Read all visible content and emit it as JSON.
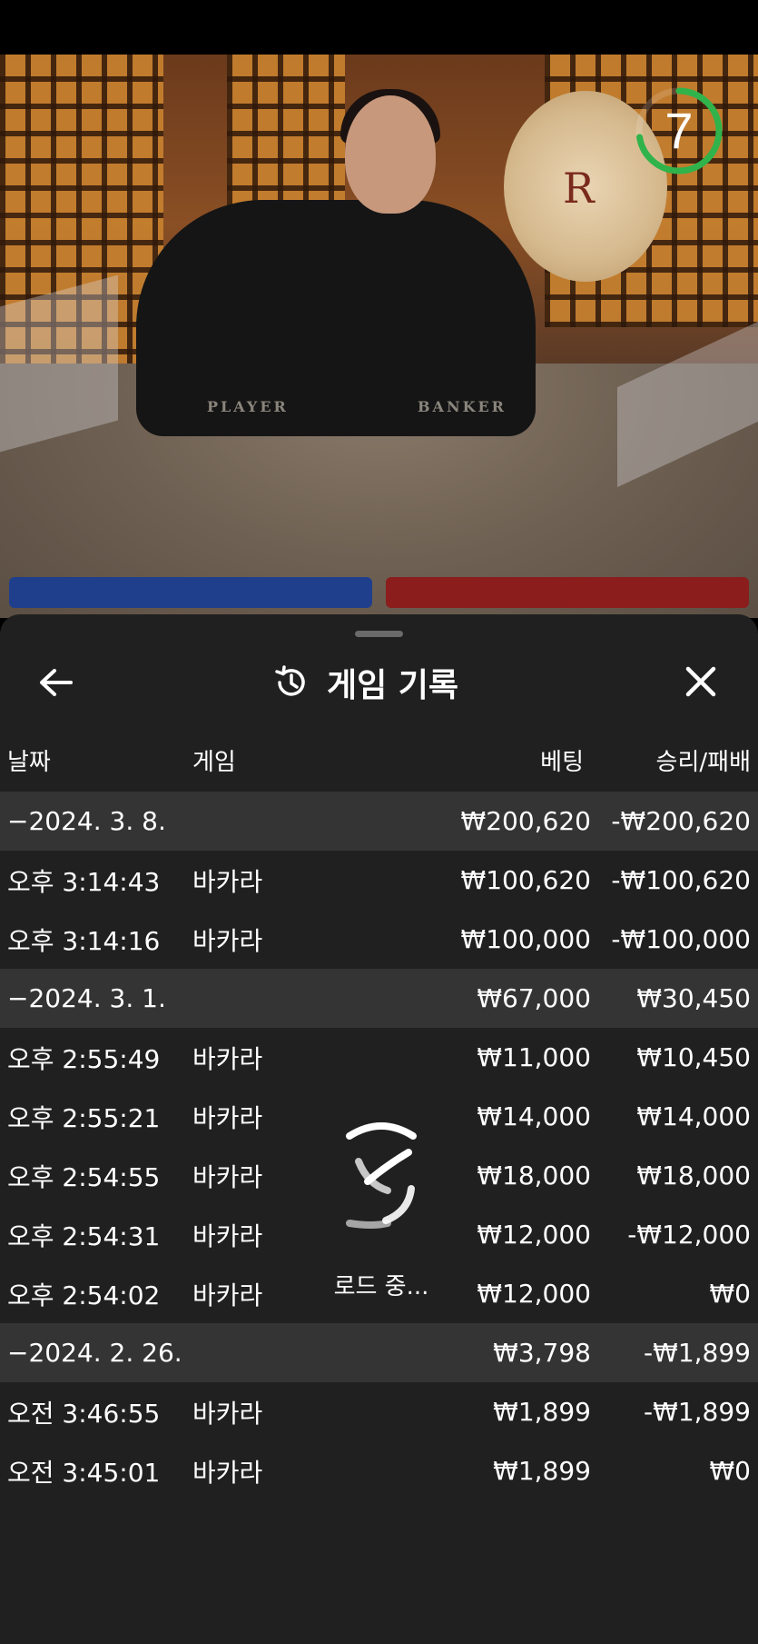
{
  "video": {
    "timer_value": "7",
    "timer_color": "#2fb34a",
    "table_label_player": "PLAYER",
    "table_label_banker": "BANKER",
    "logo_letter": "R"
  },
  "sheet": {
    "title": "게임 기록",
    "title_icon": "history-icon",
    "back_icon": "back-arrow-icon",
    "close_icon": "close-icon",
    "columns": {
      "date": "날짜",
      "game": "게임",
      "bet": "베팅",
      "result": "승리/패배"
    },
    "groups": [
      {
        "date": "−2024. 3. 8.",
        "bet": "₩200,620",
        "result": "-₩200,620",
        "items": [
          {
            "time": "오후 3:14:43",
            "game": "바카라",
            "bet": "₩100,620",
            "result": "-₩100,620"
          },
          {
            "time": "오후 3:14:16",
            "game": "바카라",
            "bet": "₩100,000",
            "result": "-₩100,000"
          }
        ]
      },
      {
        "date": "−2024. 3. 1.",
        "bet": "₩67,000",
        "result": "₩30,450",
        "items": [
          {
            "time": "오후 2:55:49",
            "game": "바카라",
            "bet": "₩11,000",
            "result": "₩10,450"
          },
          {
            "time": "오후 2:55:21",
            "game": "바카라",
            "bet": "₩14,000",
            "result": "₩14,000"
          },
          {
            "time": "오후 2:54:55",
            "game": "바카라",
            "bet": "₩18,000",
            "result": "₩18,000"
          },
          {
            "time": "오후 2:54:31",
            "game": "바카라",
            "bet": "₩12,000",
            "result": "-₩12,000"
          },
          {
            "time": "오후 2:54:02",
            "game": "바카라",
            "bet": "₩12,000",
            "result": "₩0"
          }
        ]
      },
      {
        "date": "−2024. 2. 26.",
        "bet": "₩3,798",
        "result": "-₩1,899",
        "items": [
          {
            "time": "오전 3:46:55",
            "game": "바카라",
            "bet": "₩1,899",
            "result": "-₩1,899"
          },
          {
            "time": "오전 3:45:01",
            "game": "바카라",
            "bet": "₩1,899",
            "result": "₩0"
          }
        ]
      }
    ],
    "loading_text": "로드 중...",
    "loading_icon": "loading-spinner-icon"
  }
}
